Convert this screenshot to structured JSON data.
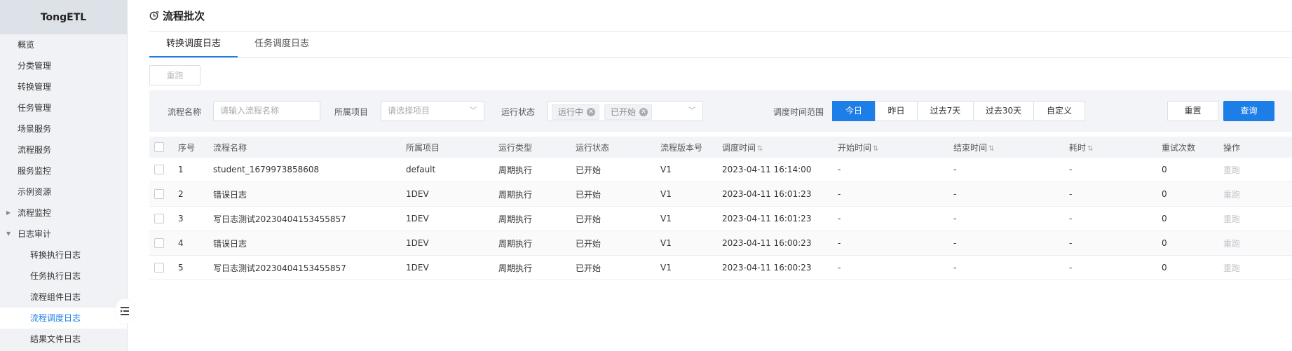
{
  "sidebar": {
    "brand": "TongETL",
    "items": [
      {
        "label": "概览"
      },
      {
        "label": "分类管理"
      },
      {
        "label": "转换管理"
      },
      {
        "label": "任务管理"
      },
      {
        "label": "场景服务"
      },
      {
        "label": "流程服务"
      },
      {
        "label": "服务监控"
      },
      {
        "label": "示例资源"
      },
      {
        "label": "流程监控"
      },
      {
        "label": "日志审计"
      },
      {
        "label": "转换执行日志"
      },
      {
        "label": "任务执行日志"
      },
      {
        "label": "流程组件日志"
      },
      {
        "label": "流程调度日志"
      },
      {
        "label": "结果文件日志"
      }
    ]
  },
  "page": {
    "title": "流程批次"
  },
  "tabs": [
    {
      "label": "转换调度日志"
    },
    {
      "label": "任务调度日志"
    }
  ],
  "toolbar": {
    "rerun_label": "重跑"
  },
  "filters": {
    "name_label": "流程名称",
    "name_placeholder": "请输入流程名称",
    "project_label": "所属项目",
    "project_placeholder": "请选择项目",
    "status_label": "运行状态",
    "status_tags": [
      "运行中",
      "已开始"
    ],
    "range_label": "调度时间范围",
    "ranges": [
      "今日",
      "昨日",
      "过去7天",
      "过去30天",
      "自定义"
    ],
    "reset_label": "重置",
    "query_label": "查询"
  },
  "table": {
    "headers": {
      "index": "序号",
      "name": "流程名称",
      "project": "所属项目",
      "run_type": "运行类型",
      "status": "运行状态",
      "version": "流程版本号",
      "schedule_time": "调度时间",
      "start_time": "开始时间",
      "end_time": "结束时间",
      "duration": "耗时",
      "retries": "重试次数",
      "action": "操作"
    },
    "rows": [
      {
        "index": "1",
        "name": "student_1679973858608",
        "project": "default",
        "run_type": "周期执行",
        "status": "已开始",
        "version": "V1",
        "schedule_time": "2023-04-11 16:14:00",
        "start_time": "-",
        "end_time": "-",
        "duration": "-",
        "retries": "0",
        "action": "重跑"
      },
      {
        "index": "2",
        "name": "错误日志",
        "project": "1DEV",
        "run_type": "周期执行",
        "status": "已开始",
        "version": "V1",
        "schedule_time": "2023-04-11 16:01:23",
        "start_time": "-",
        "end_time": "-",
        "duration": "-",
        "retries": "0",
        "action": "重跑"
      },
      {
        "index": "3",
        "name": "写日志测试20230404153455857",
        "project": "1DEV",
        "run_type": "周期执行",
        "status": "已开始",
        "version": "V1",
        "schedule_time": "2023-04-11 16:01:23",
        "start_time": "-",
        "end_time": "-",
        "duration": "-",
        "retries": "0",
        "action": "重跑"
      },
      {
        "index": "4",
        "name": "错误日志",
        "project": "1DEV",
        "run_type": "周期执行",
        "status": "已开始",
        "version": "V1",
        "schedule_time": "2023-04-11 16:00:23",
        "start_time": "-",
        "end_time": "-",
        "duration": "-",
        "retries": "0",
        "action": "重跑"
      },
      {
        "index": "5",
        "name": "写日志测试20230404153455857",
        "project": "1DEV",
        "run_type": "周期执行",
        "status": "已开始",
        "version": "V1",
        "schedule_time": "2023-04-11 16:00:23",
        "start_time": "-",
        "end_time": "-",
        "duration": "-",
        "retries": "0",
        "action": "重跑"
      }
    ]
  },
  "colors": {
    "accent": "#1e7ee8",
    "sidebar_bg": "#f0f2f5",
    "brand_bg": "#dde1e8",
    "disabled_text": "#c0c4cc"
  }
}
